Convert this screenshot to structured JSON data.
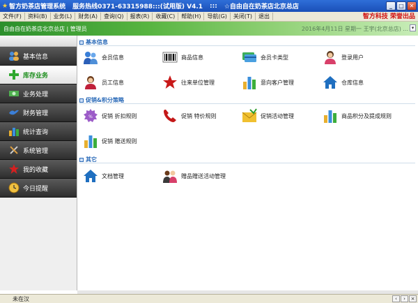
{
  "window": {
    "title_main": "智方奶茶店管理系统",
    "title_hotline": "服务热线0371-63315988:::(试用版) V4.1",
    "title_sep": ":::",
    "title_store": "☆自由自在奶茶店北京总店"
  },
  "menubar": {
    "items": [
      "文件(F)",
      "资料(B)",
      "业务(L)",
      "财务(A)",
      "查询(Q)",
      "报表(R)",
      "收藏(C)",
      "帮助(H)",
      "导航(G)",
      "关闭(T)",
      "退出"
    ],
    "brand": "智方科技 荣誉出品"
  },
  "banner": {
    "store": "自由自在奶茶店北京总店 | 管理员",
    "info": "2016年4月11日  星期一  王宇(北京总店)  ..."
  },
  "sidebar": {
    "items": [
      {
        "label": "基本信息",
        "icon": "user-group-icon"
      },
      {
        "label": "库存业务",
        "icon": "plus-icon"
      },
      {
        "label": "业务处理",
        "icon": "money-icon"
      },
      {
        "label": "财务管理",
        "icon": "bird-icon"
      },
      {
        "label": "统计查询",
        "icon": "bar-chart-icon"
      },
      {
        "label": "系统管理",
        "icon": "tools-icon"
      },
      {
        "label": "我的收藏",
        "icon": "star-icon"
      },
      {
        "label": "今日提醒",
        "icon": "clock-icon"
      }
    ]
  },
  "sections": {
    "basic": "基本信息",
    "promo": "促销&积分策略",
    "other": "其它"
  },
  "items": {
    "member_info": "会员信息",
    "product_info": "商品信息",
    "member_card_type": "会员卡类型",
    "login_user": "登录用户",
    "staff_info": "员工信息",
    "supplier_mgmt": "往来单位管理",
    "intent_customer": "意向客户管理",
    "warehouse_info": "仓库信息",
    "promo_discount": "促销 折扣规则",
    "promo_special": "促销 特价规则",
    "promo_activity": "促销活动管理",
    "points_rules": "商品积分及提成规则",
    "promo_gift": "促销 赠送规则",
    "doc_mgmt": "文档管理",
    "gift_activity": "赠品赠送活动管理"
  },
  "status": {
    "state": "未在汉"
  }
}
